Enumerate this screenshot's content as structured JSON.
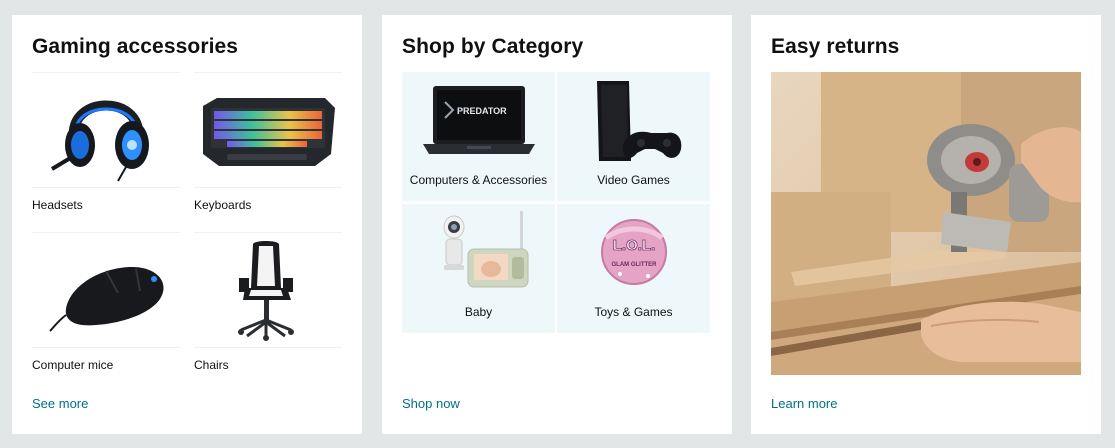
{
  "cards": {
    "gaming": {
      "title": "Gaming accessories",
      "items": [
        {
          "label": "Headsets",
          "icon": "headset-icon"
        },
        {
          "label": "Keyboards",
          "icon": "keyboard-icon"
        },
        {
          "label": "Computer mice",
          "icon": "mouse-icon"
        },
        {
          "label": "Chairs",
          "icon": "gaming-chair-icon"
        }
      ],
      "link": "See more"
    },
    "category": {
      "title": "Shop by Category",
      "items": [
        {
          "label": "Computers & Accessories",
          "icon": "laptop-icon",
          "screen_text": "PREDATOR"
        },
        {
          "label": "Video Games",
          "icon": "console-icon"
        },
        {
          "label": "Baby",
          "icon": "baby-monitor-icon"
        },
        {
          "label": "Toys & Games",
          "icon": "toy-ball-icon",
          "ball_text": "L.O.L.",
          "ball_subtext": "GLAM GLITTER"
        }
      ],
      "link": "Shop now"
    },
    "returns": {
      "title": "Easy returns",
      "image": "packing-tape-box-image",
      "link": "Learn more"
    }
  },
  "colors": {
    "page_bg": "#e3e6e6",
    "card_bg": "#ffffff",
    "link": "#007185",
    "title": "#0f1111",
    "category_tile_bg": "#eef7fa",
    "headset_accent": "#1a7cff",
    "box_cardboard": "#c9a67d"
  }
}
